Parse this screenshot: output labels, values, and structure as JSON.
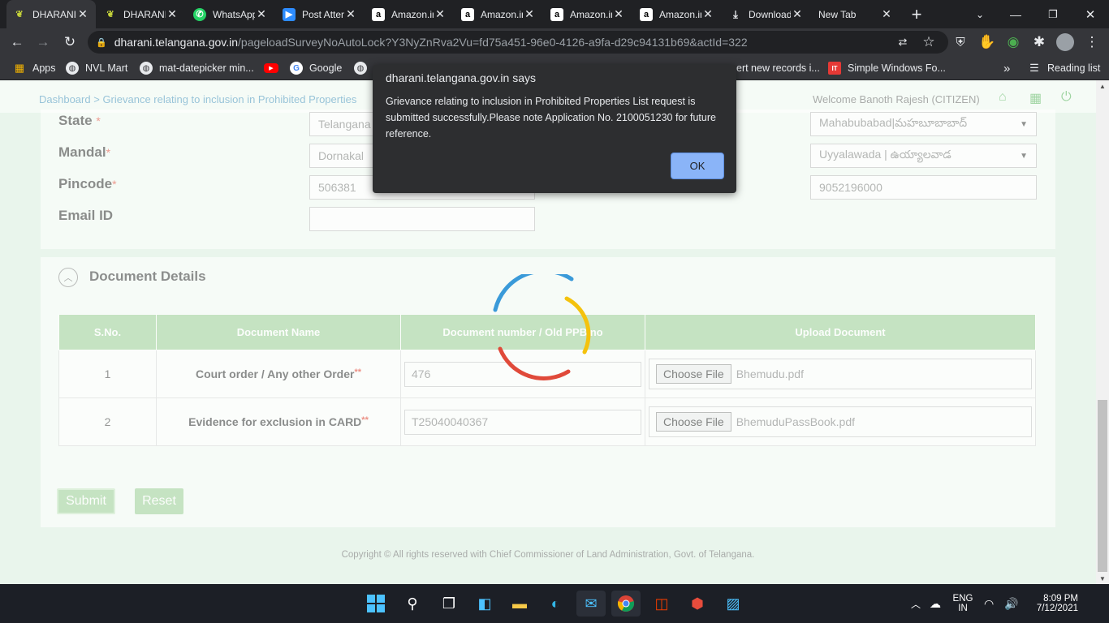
{
  "browser": {
    "tabs": [
      {
        "title": "DHARANI",
        "icon": "dharani-leaf-icon",
        "active": true
      },
      {
        "title": "DHARANI",
        "icon": "dharani-leaf-icon",
        "active": false
      },
      {
        "title": "WhatsApp",
        "icon": "whatsapp-icon",
        "active": false
      },
      {
        "title": "Post Attendance",
        "icon": "zoom-icon",
        "active": false
      },
      {
        "title": "Amazon.in",
        "icon": "amazon-icon",
        "active": false
      },
      {
        "title": "Amazon.in",
        "icon": "amazon-icon",
        "active": false
      },
      {
        "title": "Amazon.in",
        "icon": "amazon-icon",
        "active": false
      },
      {
        "title": "Amazon.in",
        "icon": "amazon-icon",
        "active": false
      },
      {
        "title": "Downloads",
        "icon": "download-icon",
        "active": false
      },
      {
        "title": "New Tab",
        "icon": "",
        "active": false
      }
    ],
    "url_host": "dharani.telangana.gov.in",
    "url_path": "/pageloadSurveyNoAutoLock?Y3NyZnRva2Vu=fd75a451-96e0-4126-a9fa-d29c94131b69&actId=322",
    "bookmarks": [
      {
        "label": "Apps",
        "icon": "apps-grid-icon"
      },
      {
        "label": "NVL Mart",
        "icon": "globe-icon"
      },
      {
        "label": "mat-datepicker min...",
        "icon": "globe-icon"
      },
      {
        "label": "",
        "icon": "youtube-icon"
      },
      {
        "label": "Google",
        "icon": "google-icon"
      },
      {
        "label": "",
        "icon": "globe-icon"
      },
      {
        "label": "ert new records i...",
        "icon": ""
      },
      {
        "label": "Simple Windows Fo...",
        "icon": "it-icon"
      }
    ],
    "more_bookmarks": "»",
    "reading_list": "Reading list"
  },
  "page": {
    "breadcrumb_home": "Dashboard",
    "breadcrumb_sep": " > ",
    "breadcrumb_current": "Grievance relating to inclusion in Prohibited Properties",
    "welcome": "Welcome  Banoth Rajesh (CITIZEN)",
    "labels": {
      "state": "State",
      "mandal": "Mandal",
      "pincode": "Pincode",
      "email": "Email ID"
    },
    "required_mark": "*",
    "fields": {
      "state": "Telangana",
      "mandal": "Dornakal",
      "pincode": "506381",
      "email": "",
      "district": "Mahabubabad|మహబూబాబాద్",
      "village": "Uyyalawada | ఉయ్యాలవాడ",
      "mobile": "9052196000"
    },
    "document_details": "Document Details",
    "table_headers": [
      "S.No.",
      "Document Name",
      "Document number / Old PPB no",
      "Upload Document"
    ],
    "rows": [
      {
        "sno": "1",
        "name": "Court order / Any other Order",
        "number": "476",
        "file": "Bhemudu.pdf"
      },
      {
        "sno": "2",
        "name": "Evidence for exclusion in CARD",
        "number": "T25040040367",
        "file": "BhemuduPassBook.pdf"
      }
    ],
    "double_asterisk": "**",
    "choose_file": "Choose File",
    "submit": "Submit",
    "reset": "Reset",
    "copyright": "Copyright © All rights reserved with Chief Commissioner of Land Administration, Govt. of Telangana."
  },
  "dialog": {
    "title": "dharani.telangana.gov.in says",
    "message": "Grievance relating to inclusion in Prohibited Properties List request is submitted successfully.Please note Application No.  2100051230 for future reference.",
    "ok": "OK"
  },
  "taskbar": {
    "lang": "ENG",
    "region": "IN",
    "time": "8:09 PM",
    "date": "7/12/2021"
  },
  "colors": {
    "accent_green": "#a6d4a0",
    "link_blue": "#3c8dbc",
    "dialog_button": "#8ab4f8"
  }
}
